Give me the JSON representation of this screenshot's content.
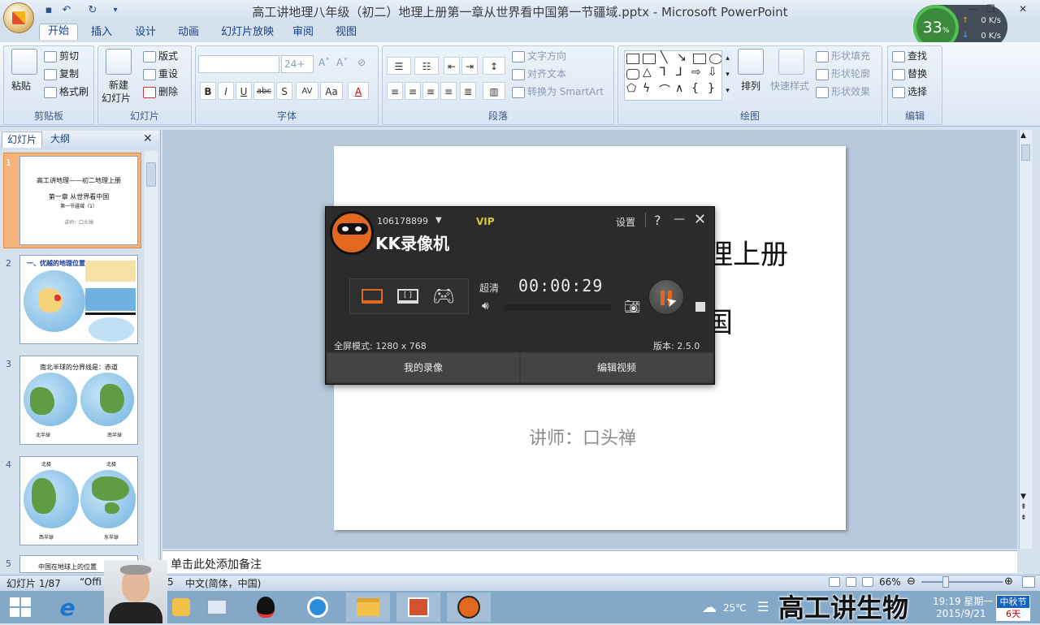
{
  "app": {
    "title": "高工讲地理八年级（初二）地理上册第一章从世界看中国第一节疆域.pptx - Microsoft PowerPoint"
  },
  "speed_widget": {
    "percent": "33",
    "unit": "%",
    "up": "0 K/s",
    "down": "0 K/s"
  },
  "tabs": [
    "开始",
    "插入",
    "设计",
    "动画",
    "幻灯片放映",
    "审阅",
    "视图"
  ],
  "ribbon": {
    "clipboard": {
      "label": "剪贴板",
      "paste": "粘贴",
      "cut": "剪切",
      "copy": "复制",
      "format_painter": "格式刷"
    },
    "slides": {
      "label": "幻灯片",
      "new_slide_line1": "新建",
      "new_slide_line2": "幻灯片",
      "layout": "版式",
      "reset": "重设",
      "delete": "删除"
    },
    "font": {
      "label": "字体",
      "size": "24+",
      "bold": "B",
      "italic": "I",
      "underline": "U",
      "strike": "abc",
      "shadow": "S",
      "spacing": "AV",
      "case": "Aa"
    },
    "paragraph": {
      "label": "段落",
      "text_direction": "文字方向",
      "align_text": "对齐文本",
      "smartart": "转换为 SmartArt"
    },
    "drawing": {
      "label": "绘图",
      "arrange": "排列",
      "quick_styles": "快速样式",
      "shape_fill": "形状填充",
      "shape_outline": "形状轮廓",
      "shape_effects": "形状效果"
    },
    "editing": {
      "label": "编辑",
      "find": "查找",
      "replace": "替换",
      "select": "选择"
    }
  },
  "left_pane": {
    "tab_slides": "幻灯片",
    "tab_outline": "大纲",
    "thumbs": [
      {
        "num": "1",
        "line1": "高工讲地理——初二地理上册",
        "line2": "第一章 从世界看中国",
        "line3": "第一节疆域（1）",
        "line4": "讲师：口头禅"
      },
      {
        "num": "2",
        "title": "一、优越的地理位置"
      },
      {
        "num": "3",
        "title": "南北半球的分界线是：赤道",
        "left": "北半球",
        "right": "南半球"
      },
      {
        "num": "4",
        "top_left": "北极",
        "top_right": "北极",
        "bottom_left": "西半球",
        "bottom_right": "东半球"
      },
      {
        "num": "5",
        "title": "中国在地球上的位置"
      }
    ]
  },
  "slide": {
    "main_title": "理上册",
    "subtitle": "国",
    "lecturer": "讲师：口头禅"
  },
  "notes": {
    "placeholder": "单击此处添加备注"
  },
  "status": {
    "slide_count": "幻灯片 1/87",
    "theme": "“Offi",
    "theme_suffix": "5",
    "language": "中文(简体，中国)",
    "zoom": "66%"
  },
  "kk": {
    "account": "106178899",
    "vip": "VIP",
    "settings": "设置",
    "help": "?",
    "brand": "KK录像机",
    "quality": "超清",
    "timer": "00:00:29",
    "mode": "全屏模式: 1280 x 768",
    "version": "版本: 2.5.0",
    "my_recordings": "我的录像",
    "edit_video": "编辑视频"
  },
  "taskbar": {
    "temperature": "25℃",
    "time": "19:19 星期一",
    "date": "2015/9/21",
    "festival": "中秋节",
    "days": "6天"
  },
  "watermark": "高工讲生物"
}
